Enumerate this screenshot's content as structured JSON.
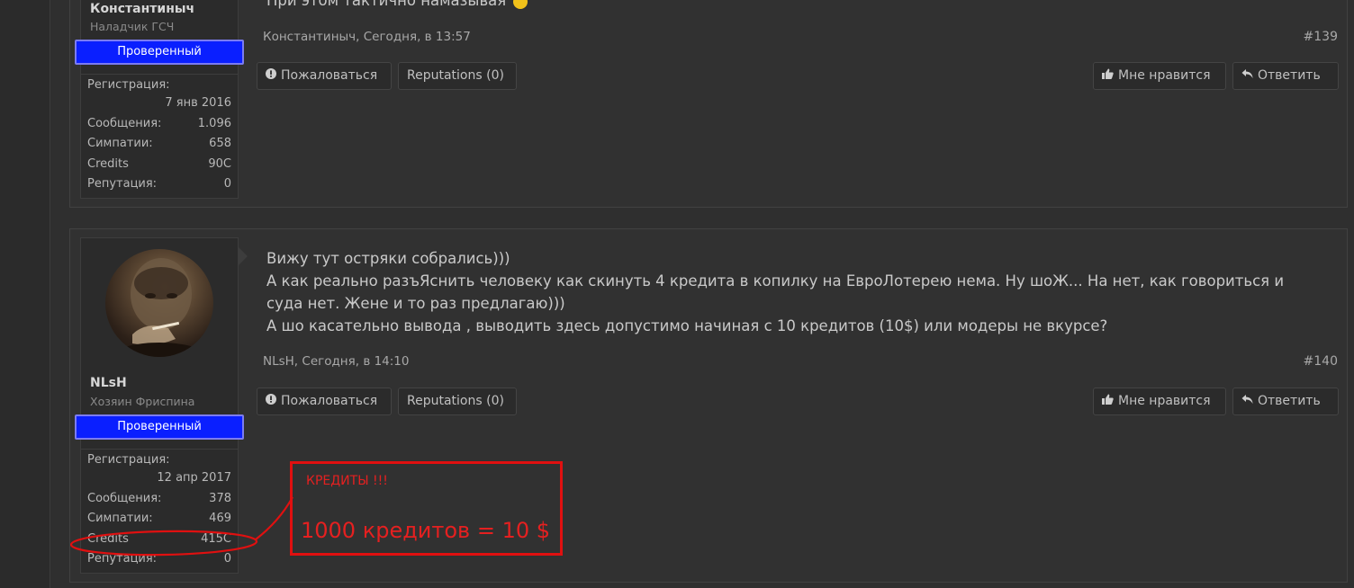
{
  "posts": [
    {
      "username": "Константиныч",
      "usertitle": "Наладчик ГСЧ",
      "badge": "Проверенный",
      "stats": {
        "reg_label": "Регистрация:",
        "reg_value": "7 янв 2016",
        "messages_label": "Сообщения:",
        "messages_value": "1.096",
        "likes_label": "Симпатии:",
        "likes_value": "658",
        "credits_label": "Credits",
        "credits_value": "90C",
        "rep_label": "Репутация:",
        "rep_value": "0"
      },
      "message_lines": [
        "При этом тактично намазывая"
      ],
      "meta": "Константиныч, Сегодня, в 13:57",
      "postnum": "#139"
    },
    {
      "username": "NLsH",
      "usertitle": "Хозяин Фриспина",
      "badge": "Проверенный",
      "stats": {
        "reg_label": "Регистрация:",
        "reg_value": "12 апр 2017",
        "messages_label": "Сообщения:",
        "messages_value": "378",
        "likes_label": "Симпатии:",
        "likes_value": "469",
        "credits_label": "Credits",
        "credits_value": "415C",
        "rep_label": "Репутация:",
        "rep_value": "0"
      },
      "message_lines": [
        "Вижу тут остряки собрались)))",
        "А как реально разъЯснить человеку как скинуть 4 кредита в копилку на ЕвроЛотерею нема. Ну шоЖ... На нет, как говориться и",
        "суда нет. Жене и то раз предлагаю)))",
        "А шо касательно вывода , выводить здесь допустимо начиная с 10 кредитов (10$) или модеры не вкурсе?"
      ],
      "meta": "NLsH, Сегодня, в 14:10",
      "postnum": "#140"
    }
  ],
  "buttons": {
    "report": "Пожаловаться",
    "reputations": "Reputations (0)",
    "like": "Мне нравится",
    "reply": "Ответить"
  },
  "annotation": {
    "title": "КРЕДИТЫ !!!",
    "main": "1000 кредитов = 10 $",
    "color": "#e01010"
  },
  "colors": {
    "badge_bg": "#0a1fff",
    "page_bg": "#2f2f2f"
  },
  "icons": {
    "report": "exclamation-circle-icon",
    "like": "thumbs-up-icon",
    "reply": "reply-arrow-icon",
    "smiley": "laughing-emoji-icon"
  }
}
